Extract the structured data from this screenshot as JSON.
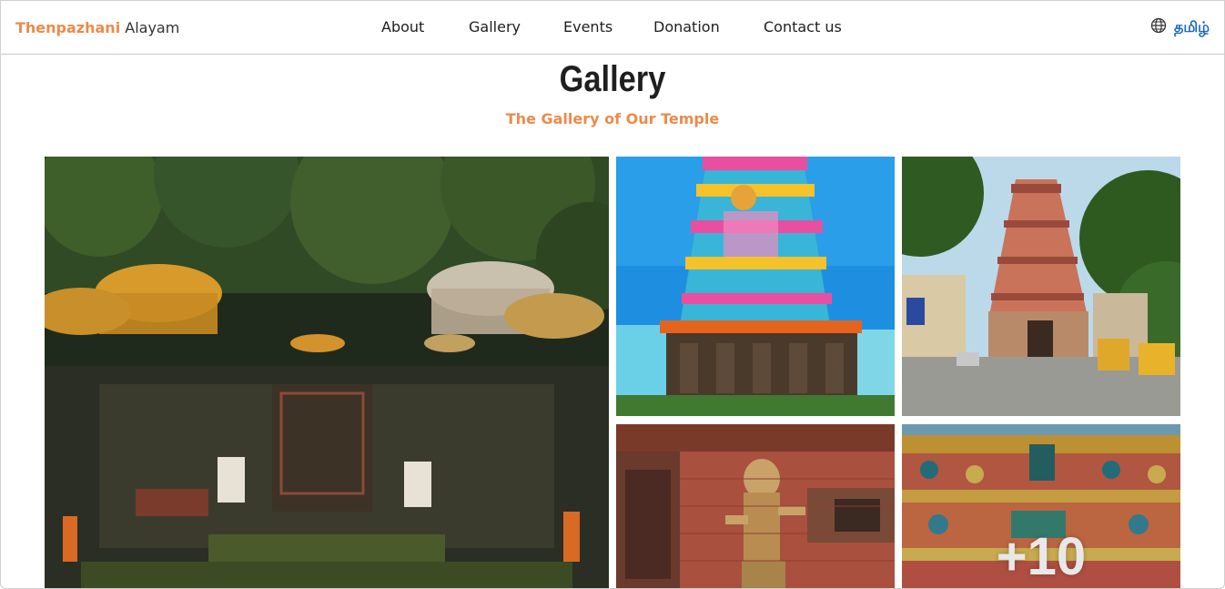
{
  "brand": {
    "primary": "Thenpazhani",
    "secondary": " Alayam",
    "accent_color": "#ee8a4a"
  },
  "nav": {
    "items": [
      "About",
      "Gallery",
      "Events",
      "Donation",
      "Contact us"
    ]
  },
  "language": {
    "icon": "globe-icon",
    "label": "தமிழ்",
    "color": "#1565c0"
  },
  "page": {
    "title": "Gallery",
    "subtitle": "The Gallery of Our Temple"
  },
  "gallery": {
    "images": [
      {
        "name": "forest-shrine-umbrellas"
      },
      {
        "name": "colorful-gopuram-blue-sky"
      },
      {
        "name": "temple-tower-street"
      },
      {
        "name": "goddess-statue-brick-wall"
      },
      {
        "name": "gopuram-sculptures-closeup"
      }
    ],
    "more_count": "+10"
  }
}
